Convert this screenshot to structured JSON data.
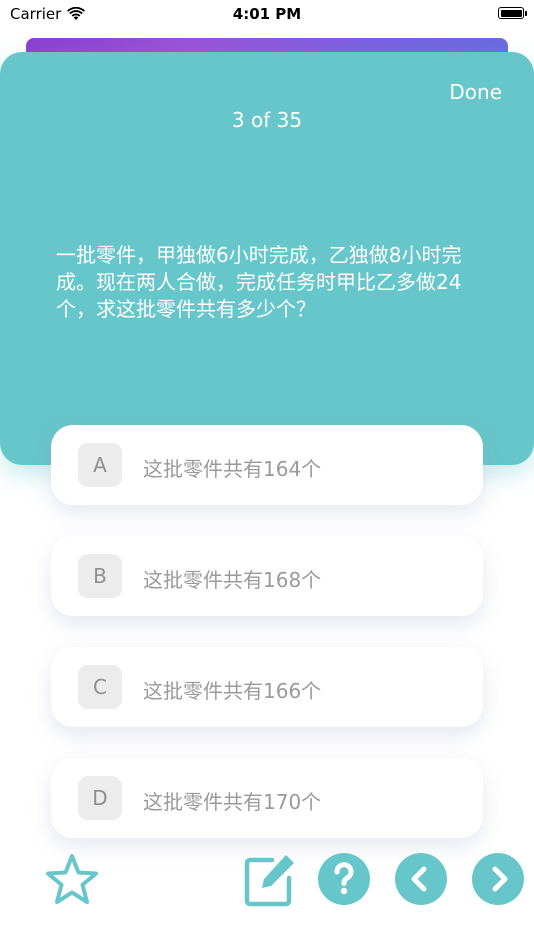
{
  "status_bar": {
    "carrier": "Carrier",
    "time": "4:01 PM"
  },
  "header": {
    "done_label": "Done",
    "progress": "3 of 35"
  },
  "question": {
    "text": "一批零件，甲独做6小时完成，乙独做8小时完成。现在两人合做，完成任务时甲比乙多做24个，求这批零件共有多少个？"
  },
  "options": [
    {
      "letter": "A",
      "text": "这批零件共有164个"
    },
    {
      "letter": "B",
      "text": "这批零件共有168个"
    },
    {
      "letter": "C",
      "text": "这批零件共有166个"
    },
    {
      "letter": "D",
      "text": "这批零件共有170个"
    }
  ],
  "toolbar": {
    "icons": [
      "star-icon",
      "edit-note-icon",
      "help-icon",
      "chevron-left-icon",
      "chevron-right-icon"
    ]
  },
  "colors": {
    "accent": "#67c6ca",
    "option_text": "#9a9a9a",
    "letter_badge_bg": "#ececec"
  }
}
